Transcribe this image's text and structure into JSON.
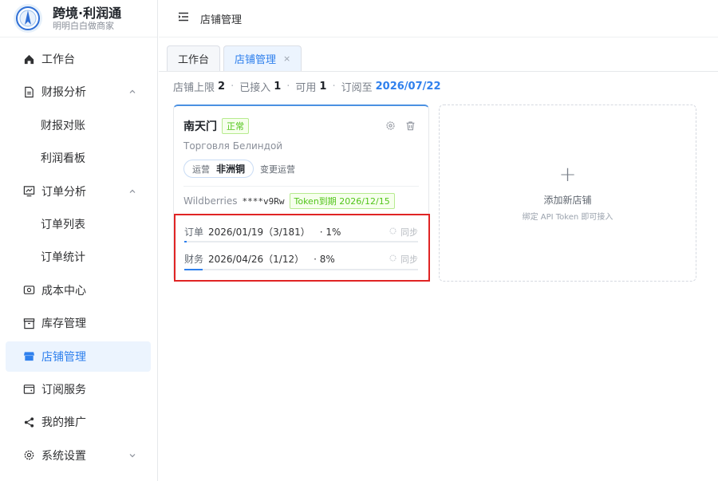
{
  "brand": {
    "title": "跨境·利润通",
    "subtitle": "明明白白做商家"
  },
  "header": {
    "title": "店铺管理"
  },
  "sidebar": {
    "items": [
      {
        "label": "工作台",
        "icon": "home-icon"
      },
      {
        "label": "财报分析",
        "icon": "document-icon",
        "expanded": true
      },
      {
        "label": "财报对账",
        "sub": true
      },
      {
        "label": "利润看板",
        "sub": true
      },
      {
        "label": "订单分析",
        "icon": "chart-icon",
        "expanded": true
      },
      {
        "label": "订单列表",
        "sub": true
      },
      {
        "label": "订单统计",
        "sub": true
      },
      {
        "label": "成本中心",
        "icon": "money-icon"
      },
      {
        "label": "库存管理",
        "icon": "box-icon"
      },
      {
        "label": "店铺管理",
        "icon": "store-icon",
        "active": true
      },
      {
        "label": "订阅服务",
        "icon": "wallet-icon"
      },
      {
        "label": "我的推广",
        "icon": "share-icon"
      },
      {
        "label": "系统设置",
        "icon": "gear-icon"
      }
    ]
  },
  "tabs": [
    {
      "label": "工作台",
      "active": false
    },
    {
      "label": "店铺管理",
      "active": true,
      "close": "×"
    }
  ],
  "summary": {
    "limit_label": "店铺上限",
    "limit_value": "2",
    "connected_label": "已接入",
    "connected_value": "1",
    "available_label": "可用",
    "available_value": "1",
    "expire_label": "订阅至",
    "expire_value": "2026/07/22",
    "separator": "·"
  },
  "store": {
    "name": "南天门",
    "status": "正常",
    "subtitle": "Торговля Белиндой",
    "operator_label": "运营",
    "operator_name": "非洲铜",
    "change_operator": "变更运营",
    "platform": "Wildberries",
    "token_mask": "****v9Rw",
    "token_expire": "Token到期 2026/12/15",
    "sync": [
      {
        "label": "订单",
        "date": "2026/01/19（3/181）",
        "percent": "· 1%",
        "progress": 0.01,
        "action": "同步"
      },
      {
        "label": "财务",
        "date": "2026/04/26（1/12）",
        "percent": "· 8%",
        "progress": 0.08,
        "action": "同步"
      }
    ]
  },
  "add_store": {
    "title": "添加新店铺",
    "subtitle": "绑定 API Token 即可接入",
    "plus": "+"
  },
  "colors": {
    "accent": "#2f80ed",
    "success": "#52c41a",
    "highlight_border": "#e02424"
  }
}
